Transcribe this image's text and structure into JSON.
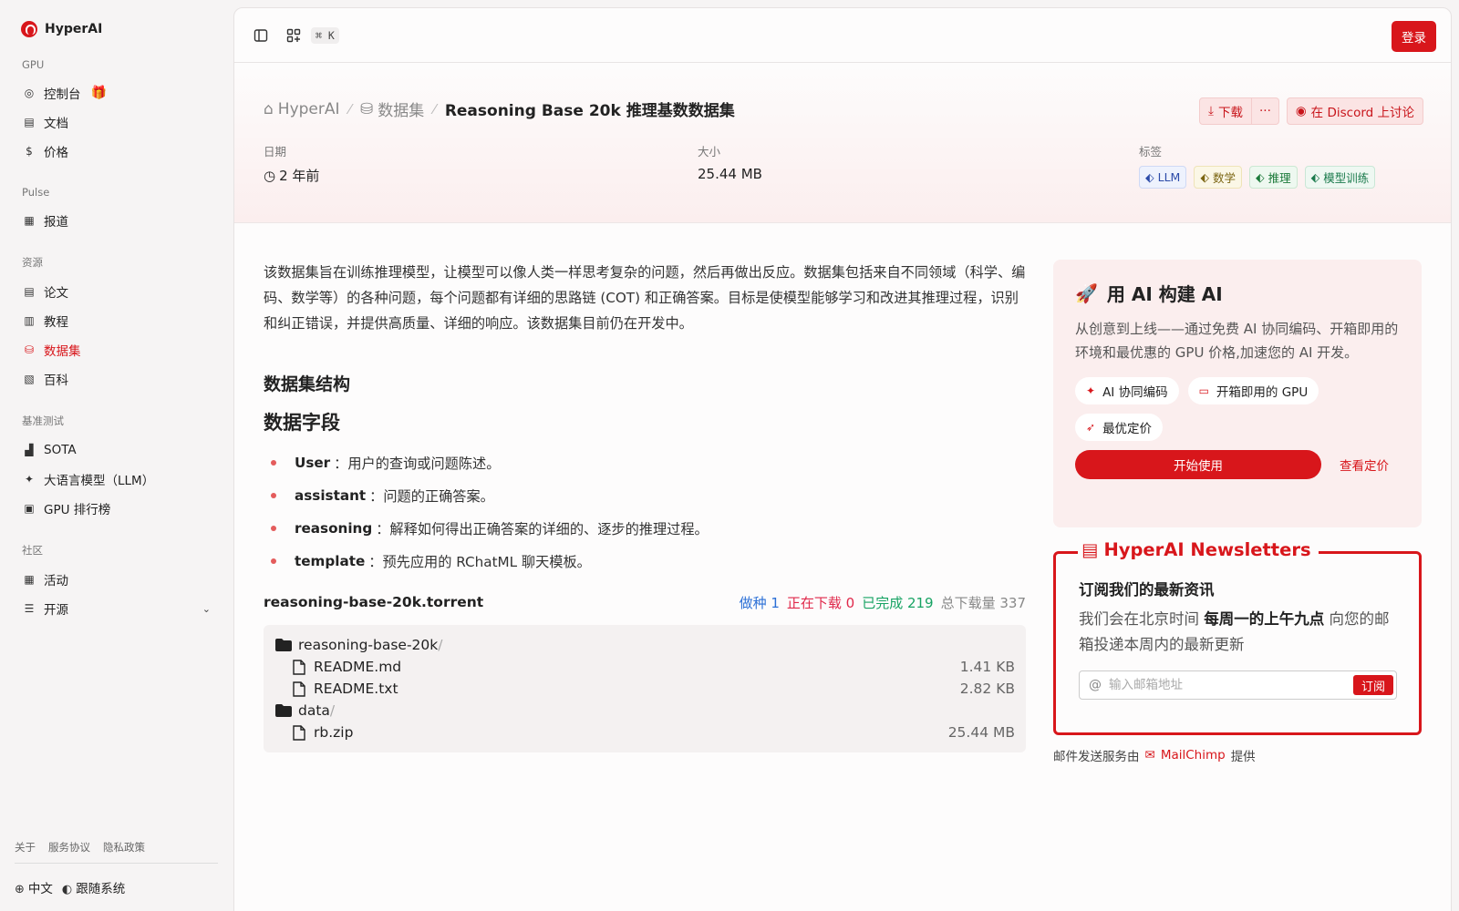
{
  "sidebar": {
    "brand": "HyperAI",
    "sections": [
      {
        "title": "GPU",
        "items": [
          {
            "label": "控制台",
            "icon": "gauge-icon"
          },
          {
            "label": "文档",
            "icon": "book-icon"
          },
          {
            "label": "价格",
            "icon": "dollar-icon"
          }
        ]
      },
      {
        "title": "Pulse",
        "items": [
          {
            "label": "报道",
            "icon": "newspaper-icon"
          }
        ]
      },
      {
        "title": "资源",
        "items": [
          {
            "label": "论文",
            "icon": "paper-icon"
          },
          {
            "label": "教程",
            "icon": "tutorial-icon"
          },
          {
            "label": "数据集",
            "icon": "database-icon"
          },
          {
            "label": "百科",
            "icon": "wiki-icon"
          }
        ]
      },
      {
        "title": "基准测试",
        "items": [
          {
            "label": "SOTA",
            "icon": "bar-chart-icon"
          },
          {
            "label": "大语言模型（LLM）",
            "icon": "sparkle-icon"
          },
          {
            "label": "GPU 排行榜",
            "icon": "chip-icon"
          }
        ]
      },
      {
        "title": "社区",
        "items": [
          {
            "label": "活动",
            "icon": "calendar-icon"
          },
          {
            "label": "开源",
            "icon": "list-icon"
          }
        ]
      }
    ],
    "footer_links": [
      "关于",
      "服务协议",
      "隐私政策"
    ],
    "language": "中文",
    "theme": "跟随系统"
  },
  "topbar": {
    "shortcut": "⌘ K",
    "login": "登录"
  },
  "header": {
    "crumb_home": "HyperAI",
    "crumb_section": "数据集",
    "crumb_current": "Reasoning Base 20k 推理基数数据集",
    "download": "下载",
    "discord": "在 Discord 上讨论",
    "date_label": "日期",
    "date_value": "2 年前",
    "size_label": "大小",
    "size_value": "25.44 MB",
    "tags_label": "标签",
    "tags": [
      "LLM",
      "数学",
      "推理",
      "模型训练"
    ]
  },
  "content": {
    "description": "该数据集旨在训练推理模型，让模型可以像人类一样思考复杂的问题，然后再做出反应。数据集包括来自不同领域（科学、编码、数学等）的各种问题，每个问题都有详细的思路链 (COT) 和正确答案。目标是使模型能够学习和改进其推理过程，识别和纠正错误，并提供高质量、详细的响应。该数据集目前仍在开发中。",
    "structure_heading": "数据集结构",
    "fields_heading": "数据字段",
    "fields": [
      {
        "name": "User",
        "desc": "：用户的查询或问题陈述。"
      },
      {
        "name": "assistant",
        "desc": "：问题的正确答案。"
      },
      {
        "name": "reasoning",
        "desc": "：解释如何得出正确答案的详细的、逐步的推理过程。"
      },
      {
        "name": "template",
        "desc": "：预先应用的 RChatML 聊天模板。"
      }
    ],
    "torrent": {
      "name": "reasoning-base-20k.torrent",
      "seeding": "做种 1",
      "downloading": "正在下载 0",
      "completed": "已完成 219",
      "total": "总下载量 337",
      "files": [
        {
          "name": "reasoning-base-20k",
          "type": "folder",
          "size": ""
        },
        {
          "name": "README.md",
          "type": "file",
          "size": "1.41 KB"
        },
        {
          "name": "README.txt",
          "type": "file",
          "size": "2.82 KB"
        },
        {
          "name": "data",
          "type": "folder",
          "size": ""
        },
        {
          "name": "rb.zip",
          "type": "file",
          "size": "25.44 MB"
        }
      ]
    }
  },
  "promo": {
    "title": "用 AI 构建 AI",
    "text": "从创意到上线——通过免费 AI 协同编码、开箱即用的环境和最优惠的 GPU 价格,加速您的 AI 开发。",
    "chips": [
      "AI 协同编码",
      "开箱即用的 GPU",
      "最优定价"
    ],
    "start": "开始使用",
    "pricing": "查看定价"
  },
  "newsletter": {
    "title": "HyperAI Newsletters",
    "heading": "订阅我们的最新资讯",
    "text_pre": "我们会在北京时间 ",
    "text_bold": "每周一的上午九点",
    "text_post": " 向您的邮箱投递本周内的最新更新",
    "placeholder": "输入邮箱地址",
    "subscribe": "订阅",
    "note_pre": "邮件发送服务由",
    "note_brand": "MailChimp",
    "note_post": "提供"
  },
  "colors": {
    "accent": "#d8161b"
  }
}
